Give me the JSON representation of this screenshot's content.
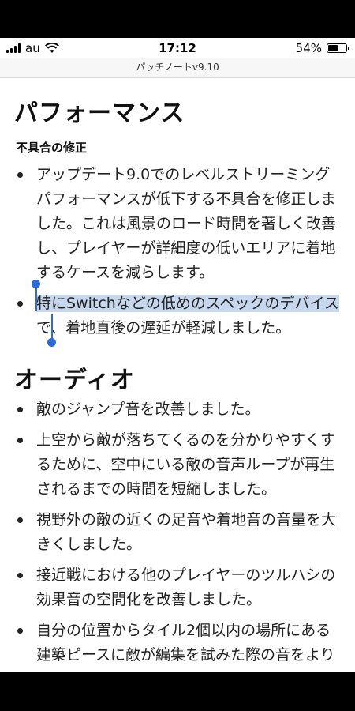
{
  "status": {
    "carrier": "au",
    "time": "17:12",
    "battery_text": "54%",
    "battery_level": 0.54
  },
  "url_title": "パッチノートv9.10",
  "sections": {
    "performance": {
      "title": "パフォーマンス",
      "subheading": "不具合の修正",
      "items": [
        "アップデート9.0でのレベルストリーミングパフォーマンスが低下する不具合を修正しました。これは風景のロード時間を著しく改善し、プレイヤーが詳細度の低いエリアに着地するケースを減らします。",
        {
          "selected": "特にSwitchなどの低めのスペックのデバイス",
          "rest": "で、着地直後の遅延が軽減しました。"
        }
      ]
    },
    "audio": {
      "title": "オーディオ",
      "items": [
        "敵のジャンプ音を改善しました。",
        "上空から敵が落ちてくるのを分かりやすくするために、空中にいる敵の音声ループが再生されるまでの時間を短縮しました。",
        "視野外の敵の近くの足音や着地音の音量を大きくしました。",
        "接近戦における他のプレイヤーのツルハシの効果音の空間化を改善しました。",
        "自分の位置からタイル2個以内の場所にある建築ピースに敵が編集を試みた際の音をより"
      ]
    }
  },
  "icons": {
    "signal": "signal-bars-icon",
    "wifi": "wifi-icon",
    "battery": "battery-icon"
  }
}
